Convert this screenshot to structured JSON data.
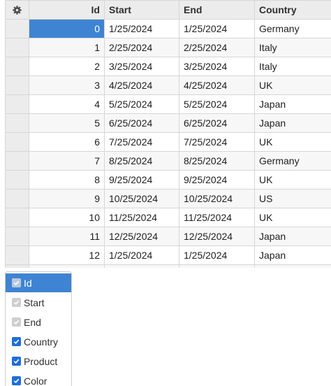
{
  "grid": {
    "columns": {
      "id": "Id",
      "start": "Start",
      "end": "End",
      "country": "Country"
    },
    "rows": [
      {
        "id": "0",
        "start": "1/25/2024",
        "end": "1/25/2024",
        "country": "Germany"
      },
      {
        "id": "1",
        "start": "2/25/2024",
        "end": "2/25/2024",
        "country": "Italy"
      },
      {
        "id": "2",
        "start": "3/25/2024",
        "end": "3/25/2024",
        "country": "Italy"
      },
      {
        "id": "3",
        "start": "4/25/2024",
        "end": "4/25/2024",
        "country": "UK"
      },
      {
        "id": "4",
        "start": "5/25/2024",
        "end": "5/25/2024",
        "country": "Japan"
      },
      {
        "id": "5",
        "start": "6/25/2024",
        "end": "6/25/2024",
        "country": "Japan"
      },
      {
        "id": "6",
        "start": "7/25/2024",
        "end": "7/25/2024",
        "country": "UK"
      },
      {
        "id": "7",
        "start": "8/25/2024",
        "end": "8/25/2024",
        "country": "Germany"
      },
      {
        "id": "8",
        "start": "9/25/2024",
        "end": "9/25/2024",
        "country": "UK"
      },
      {
        "id": "9",
        "start": "10/25/2024",
        "end": "10/25/2024",
        "country": "US"
      },
      {
        "id": "10",
        "start": "11/25/2024",
        "end": "11/25/2024",
        "country": "UK"
      },
      {
        "id": "11",
        "start": "12/25/2024",
        "end": "12/25/2024",
        "country": "Japan"
      },
      {
        "id": "12",
        "start": "1/25/2024",
        "end": "1/25/2024",
        "country": "Japan"
      }
    ],
    "selected_row": 0,
    "selected_column": "id"
  },
  "column_menu": {
    "items": [
      {
        "label": "Id",
        "checked": true,
        "disabled": true,
        "highlighted": true
      },
      {
        "label": "Start",
        "checked": true,
        "disabled": true,
        "highlighted": false
      },
      {
        "label": "End",
        "checked": true,
        "disabled": true,
        "highlighted": false
      },
      {
        "label": "Country",
        "checked": true,
        "disabled": false,
        "highlighted": false
      },
      {
        "label": "Product",
        "checked": true,
        "disabled": false,
        "highlighted": false
      },
      {
        "label": "Color",
        "checked": true,
        "disabled": false,
        "highlighted": false
      }
    ]
  },
  "icons": {
    "settings": "gear-icon",
    "check": "checkmark-icon"
  },
  "colors": {
    "selection": "#3f84d2",
    "checkbox": "#1e6fd9",
    "header_bg": "#ececec",
    "alt_row_bg": "#f7f7f7",
    "grid_line": "#d6d6d6"
  }
}
